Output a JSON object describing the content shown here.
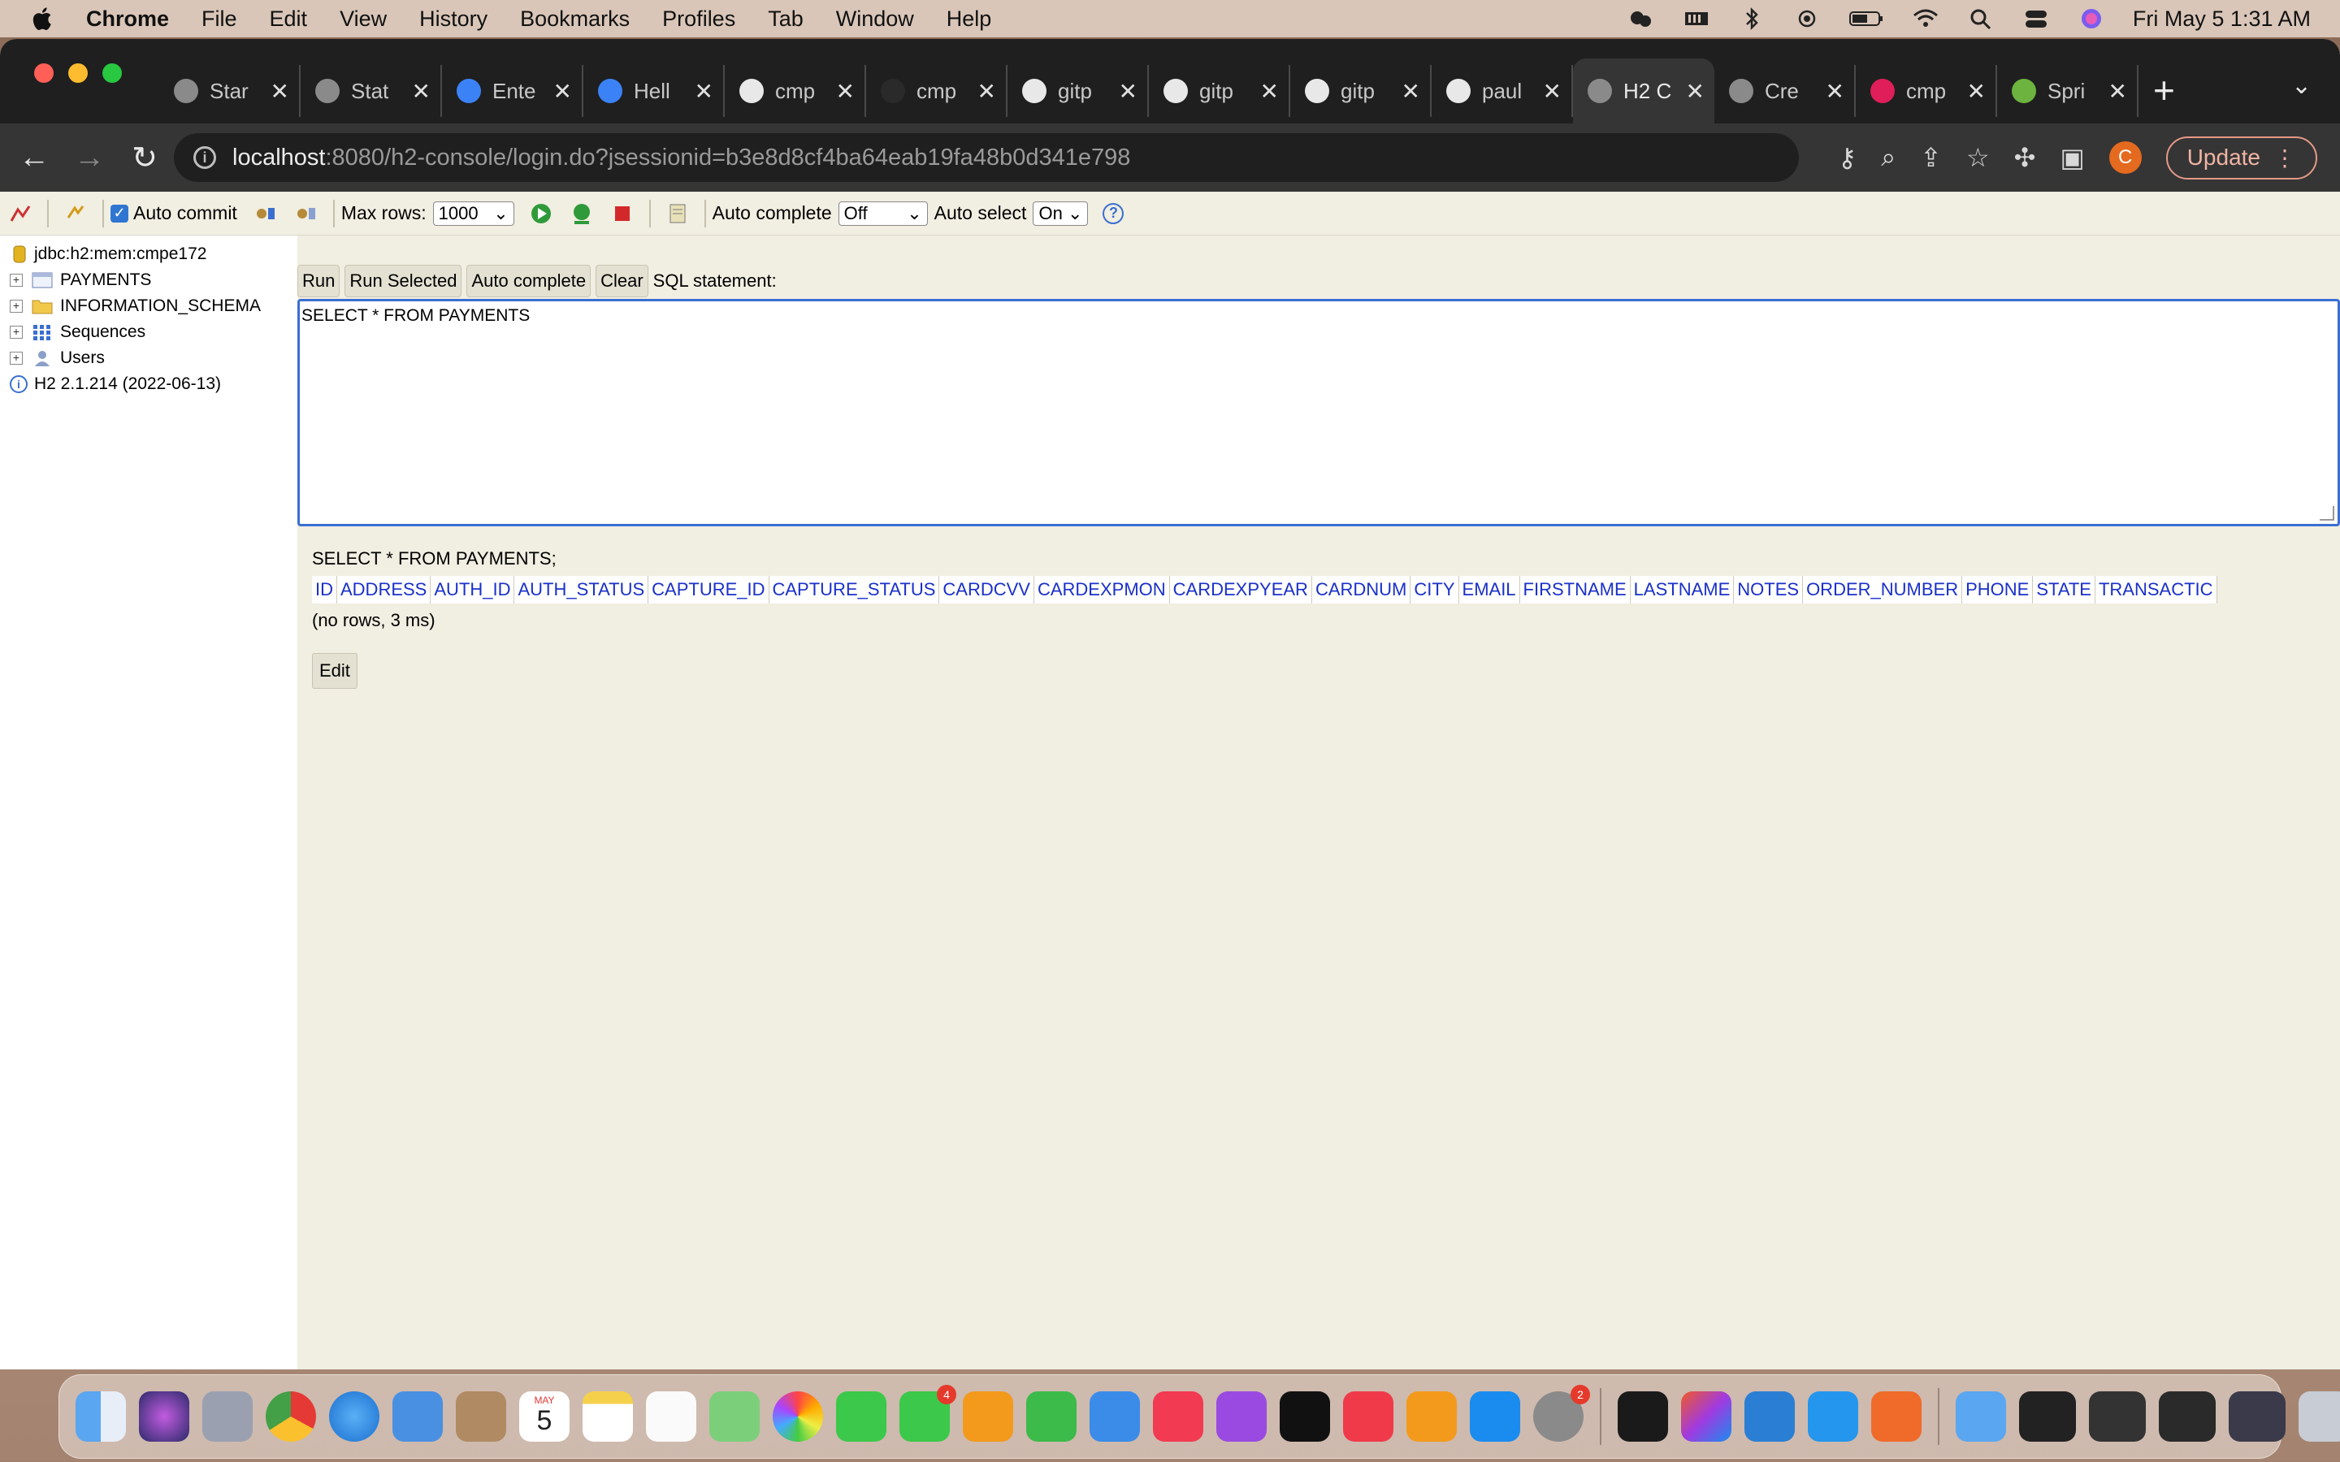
{
  "menubar": {
    "app": "Chrome",
    "items": [
      "File",
      "Edit",
      "View",
      "History",
      "Bookmarks",
      "Profiles",
      "Tab",
      "Window",
      "Help"
    ],
    "clock": "Fri May 5  1:31 AM"
  },
  "tabs": [
    {
      "title": "Star",
      "color": "#8a8a8a"
    },
    {
      "title": "Stat",
      "color": "#8a8a8a"
    },
    {
      "title": "Ente",
      "color": "#3b82f6"
    },
    {
      "title": "Hell",
      "color": "#3b82f6"
    },
    {
      "title": "cmp",
      "color": "#e8e8e8"
    },
    {
      "title": "cmp",
      "color": "#2a2a2a"
    },
    {
      "title": "gitp",
      "color": "#e8e8e8"
    },
    {
      "title": "gitp",
      "color": "#e8e8e8"
    },
    {
      "title": "gitp",
      "color": "#e8e8e8"
    },
    {
      "title": "paul",
      "color": "#e8e8e8"
    },
    {
      "title": "H2 C",
      "color": "#8a8a8a",
      "active": true
    },
    {
      "title": "Cre",
      "color": "#8a8a8a"
    },
    {
      "title": "cmp",
      "color": "#e01e5a"
    },
    {
      "title": "Spri",
      "color": "#6db33f"
    }
  ],
  "omnibox": {
    "host": "localhost",
    "path": ":8080/h2-console/login.do?jsessionid=b3e8d8cf4ba64eab19fa48b0d341e798"
  },
  "toolbar": {
    "profile_initial": "C",
    "update_label": "Update"
  },
  "h2toolbar": {
    "auto_commit_label": "Auto commit",
    "max_rows_label": "Max rows:",
    "max_rows_value": "1000",
    "auto_complete_label": "Auto complete",
    "auto_complete_value": "Off",
    "auto_select_label": "Auto select",
    "auto_select_value": "On",
    "help": "?"
  },
  "sidebar": {
    "connection": "jdbc:h2:mem:cmpe172",
    "nodes": [
      "PAYMENTS",
      "INFORMATION_SCHEMA",
      "Sequences",
      "Users"
    ],
    "version": "H2 2.1.214 (2022-06-13)"
  },
  "sql": {
    "buttons": [
      "Run",
      "Run Selected",
      "Auto complete",
      "Clear"
    ],
    "statement_label": "SQL statement:",
    "statement": "SELECT * FROM PAYMENTS"
  },
  "result": {
    "query": "SELECT * FROM PAYMENTS;",
    "columns": [
      "ID",
      "ADDRESS",
      "AUTH_ID",
      "AUTH_STATUS",
      "CAPTURE_ID",
      "CAPTURE_STATUS",
      "CARDCVV",
      "CARDEXPMON",
      "CARDEXPYEAR",
      "CARDNUM",
      "CITY",
      "EMAIL",
      "FIRSTNAME",
      "LASTNAME",
      "NOTES",
      "ORDER_NUMBER",
      "PHONE",
      "STATE",
      "TRANSACTIC"
    ],
    "status": "(no rows, 3 ms)",
    "edit_label": "Edit"
  },
  "dock": {
    "calendar_month": "MAY",
    "calendar_day": "5",
    "facetime_badge": "4",
    "settings_badge": "2"
  }
}
